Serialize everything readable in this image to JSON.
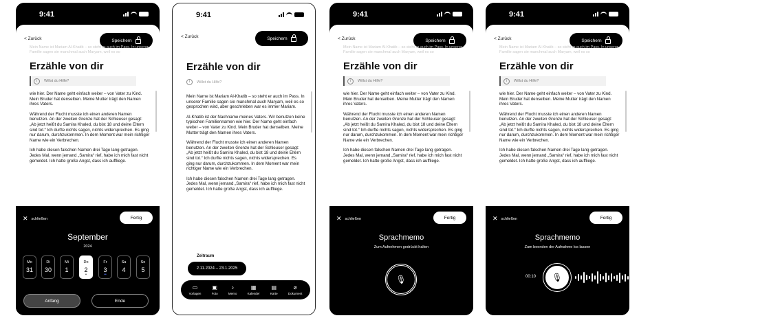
{
  "status": {
    "time": "9:41"
  },
  "nav": {
    "back": "< Zurück",
    "save": "Speichern"
  },
  "title": "Erzähle von dir",
  "help": "Willst du Hilfe?",
  "ghost_text": "Mein Name ist Mariam Al-Khatib – so steht er auch im Pass. In unserer Familie sagen sie manchmal auch Maryam, weil es so",
  "story": {
    "p1": "Mein Name ist Mariam Al-Khatib – so steht er auch im Pass. In unserer Familie sagen sie manchmal auch Maryam, weil es so gesprochen wird, aber geschrieben war es immer Mariam.",
    "p2": "Al-Khatib ist der Nachname meines Vaters. Wir benutzen keine typischen Familiennamen wie hier. Der Name geht einfach weiter – von Vater zu Kind. Mein Bruder hat denselben. Meine Mutter trägt den Namen ihres Vaters.",
    "p2_tail": "wie hier. Der Name geht einfach weiter – von Vater zu Kind. Mein Bruder hat denselben. Meine Mutter trägt den Namen ihres Vaters.",
    "p3": "Während der Flucht musste ich einen anderen Namen benutzen. An der zweiten Grenze hat der Schleuser gesagt: „Ab jetzt heißt du Samira Khaled, du bist 18 und deine Eltern sind tot.“ Ich durfte nichts sagen, nichts widersprechen. Es ging nur darum, durchzukommen. In dem Moment war mein richtiger Name wie ein Verbrechen.",
    "p4": "Ich habe diesen falschen Namen drei Tage lang getragen. Jedes Mal, wenn jemand „Samira“ rief, habe ich mich fast nicht gemeldet. Ich hatte große Angst, dass ich auffliege."
  },
  "sheet": {
    "close": "schließen",
    "done": "Fertig"
  },
  "calendar": {
    "month": "September",
    "year": "2024",
    "days": [
      {
        "w": "Mo",
        "n": "31"
      },
      {
        "w": "Di",
        "n": "30"
      },
      {
        "w": "Mi",
        "n": "1"
      },
      {
        "w": "Do",
        "n": "2"
      },
      {
        "w": "Fr",
        "n": "3"
      },
      {
        "w": "Sa",
        "n": "4"
      },
      {
        "w": "So",
        "n": "5"
      }
    ],
    "start": "Anfang",
    "end": "Ende"
  },
  "zeitraum": {
    "label": "Zeitraum",
    "range": "2.11.2024 – 23.1.2025"
  },
  "toolbar": [
    {
      "label": "Vorlagen",
      "icon": "▭"
    },
    {
      "label": "Foto",
      "icon": "▣"
    },
    {
      "label": "Memo",
      "icon": "♪"
    },
    {
      "label": "Kalender",
      "icon": "▦"
    },
    {
      "label": "Karte",
      "icon": "▤"
    },
    {
      "label": "Dokument",
      "icon": "⌀"
    }
  ],
  "memo": {
    "title": "Sprachmemo",
    "hint_hold": "Zum Aufnehmen gedrückt halten",
    "hint_release": "Zum beenden der Aufnahme los lassen",
    "timer": "00:10"
  }
}
